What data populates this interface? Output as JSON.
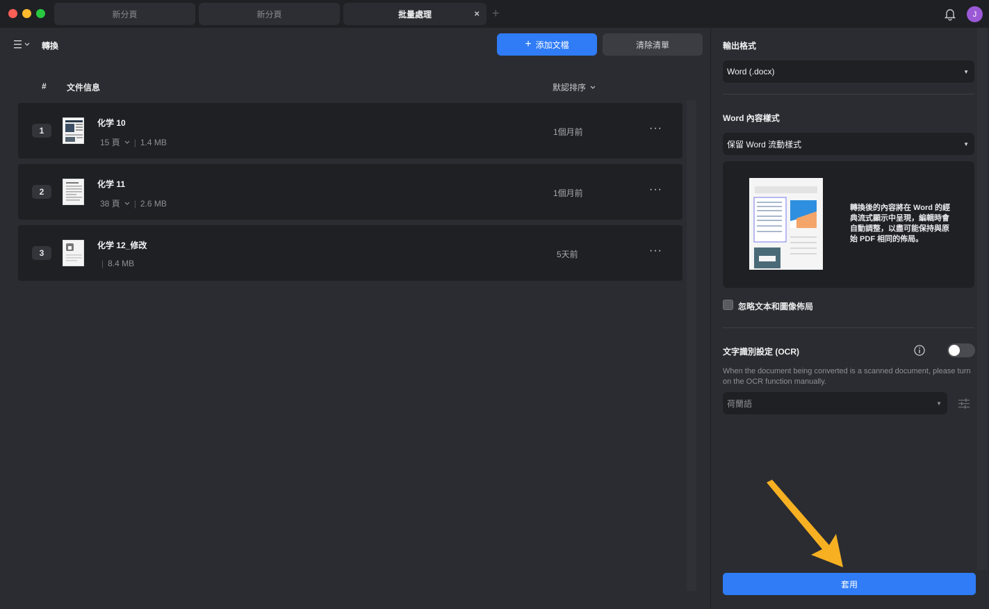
{
  "window": {
    "tabs": [
      {
        "label": "新分頁",
        "active": false
      },
      {
        "label": "新分頁",
        "active": false
      },
      {
        "label": "批量處理",
        "active": true
      }
    ],
    "tab_close": "×",
    "tab_add": "+",
    "avatar_initial": "J"
  },
  "toolbar": {
    "title": "轉換",
    "add_button": "添加文檔",
    "add_icon": "+",
    "clear_button": "清除清單"
  },
  "table": {
    "col_hash": "#",
    "col_info": "文件信息",
    "sort_label": "默認排序",
    "rows": [
      {
        "num": "1",
        "name": "化学 10",
        "pages": "15 頁",
        "size": "1.4 MB",
        "time": "1個月前"
      },
      {
        "num": "2",
        "name": "化学 11",
        "pages": "38 頁",
        "size": "2.6 MB",
        "time": "1個月前"
      },
      {
        "num": "3",
        "name": "化学 12_修改",
        "pages": "",
        "size": "8.4 MB",
        "time": "5天前"
      }
    ],
    "more": "···"
  },
  "sidebar": {
    "output_label": "輸出格式",
    "output_value": "Word (.docx)",
    "content_label": "Word 內容樣式",
    "content_value": "保留 Word 流動樣式",
    "preview_text": "轉換後的內容將在 Word 的經典流式顯示中呈現，編輯時會自動調整，以盡可能保持與原始 PDF 相同的佈局。",
    "ignore_layout": "忽略文本和圖像佈局",
    "ocr_label": "文字識別設定 (OCR)",
    "ocr_desc": "When the document being converted is a scanned document, please turn on the OCR function manually.",
    "ocr_enabled": false,
    "lang_value": "荷蘭語",
    "apply_button": "套用"
  },
  "colors": {
    "accent": "#2f7cf6",
    "annotation_arrow": "#f6b022"
  }
}
